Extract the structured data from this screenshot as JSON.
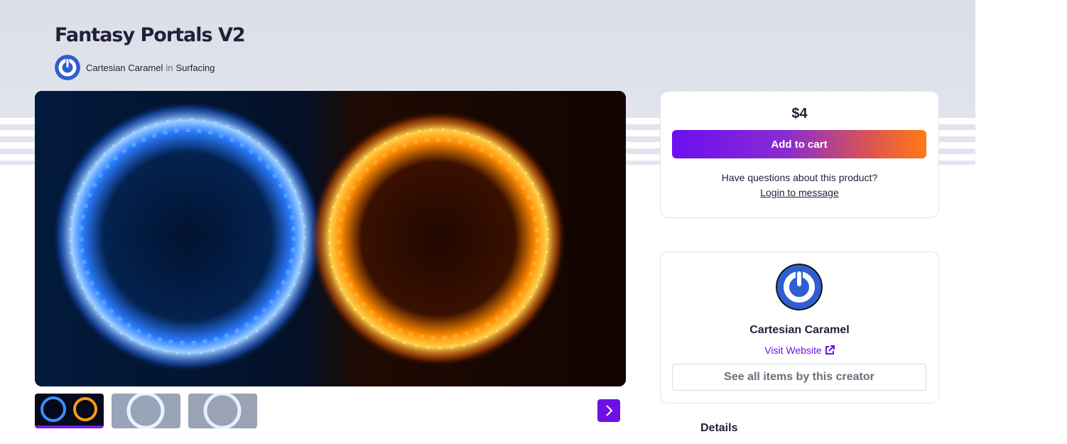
{
  "product": {
    "title": "Fantasy Portals V2",
    "author": "Cartesian Caramel",
    "in_word": "in",
    "category": "Surfacing"
  },
  "purchase": {
    "price": "$4",
    "add_to_cart": "Add to cart",
    "question": "Have questions about this product?",
    "login_link": "Login to message"
  },
  "creator": {
    "name": "Cartesian Caramel",
    "visit_website": "Visit Website",
    "see_all": "See all items by this creator"
  },
  "details": {
    "heading": "Details"
  },
  "gallery": {
    "thumbnail_count": 3,
    "active_index": 0,
    "next_icon": "chevron-right-icon"
  },
  "colors": {
    "accent": "#6d12e6",
    "cart_gradient": [
      "#6b0ff0",
      "#ff7a14"
    ],
    "avatar_blue": "#2d5fd1"
  }
}
